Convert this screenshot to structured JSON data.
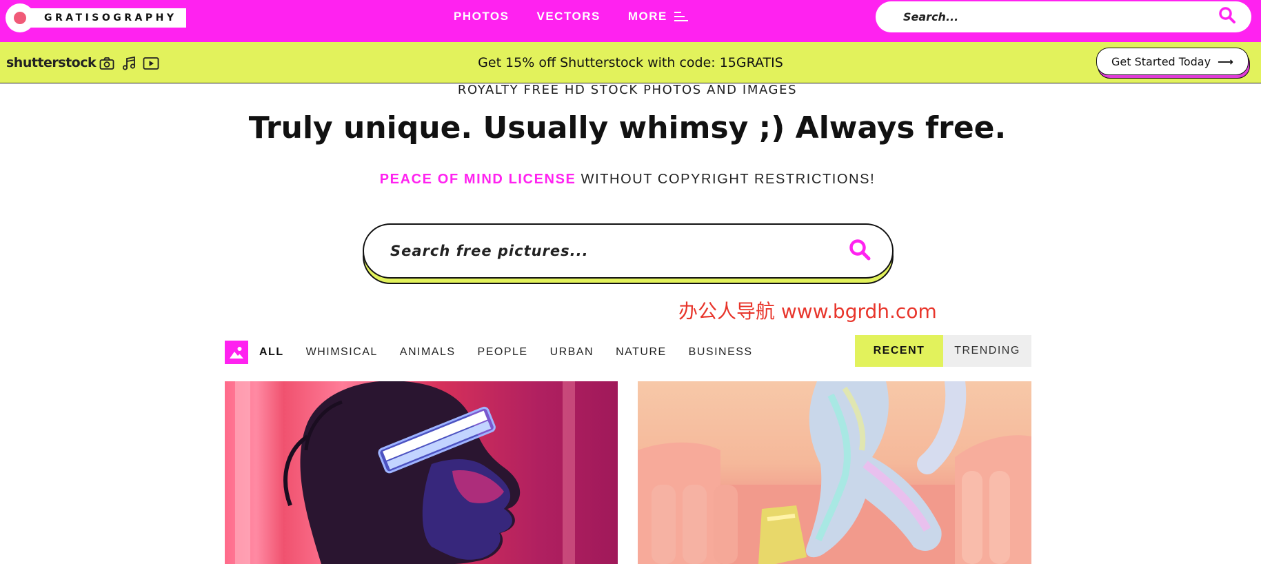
{
  "topbar": {
    "logo_text": "GRATISOGRAPHY",
    "nav": [
      {
        "label": "PHOTOS"
      },
      {
        "label": "VECTORS"
      },
      {
        "label": "MORE"
      }
    ],
    "search_placeholder": "Search...",
    "colors": {
      "background": "#ff22f0"
    }
  },
  "promo": {
    "brand": "shutterstock",
    "icons": [
      "camera-icon",
      "music-note-icon",
      "video-play-icon"
    ],
    "message": "Get 15% off Shutterstock with code: 15GRATIS",
    "cta_label": "Get Started Today",
    "colors": {
      "background": "#e2f25c"
    }
  },
  "hero": {
    "eyebrow": "ROYALTY FREE HD STOCK PHOTOS AND IMAGES",
    "headline": "Truly unique. Usually whimsy ;) Always free.",
    "license_link": "PEACE OF MIND LICENSE",
    "license_rest": " WITHOUT COPYRIGHT RESTRICTIONS!",
    "search_placeholder": "Search free pictures..."
  },
  "watermark": "办公人导航 www.bgrdh.com",
  "filters": {
    "categories": [
      "ALL",
      "WHIMSICAL",
      "ANIMALS",
      "PEOPLE",
      "URBAN",
      "NATURE",
      "BUSINESS"
    ],
    "active": "ALL",
    "sort": [
      "RECENT",
      "TRENDING"
    ],
    "sort_active": "RECENT"
  },
  "photos": [
    {
      "subject": "person-with-glowing-visor"
    },
    {
      "subject": "holographic-outfit-on-pink-sofa"
    }
  ]
}
